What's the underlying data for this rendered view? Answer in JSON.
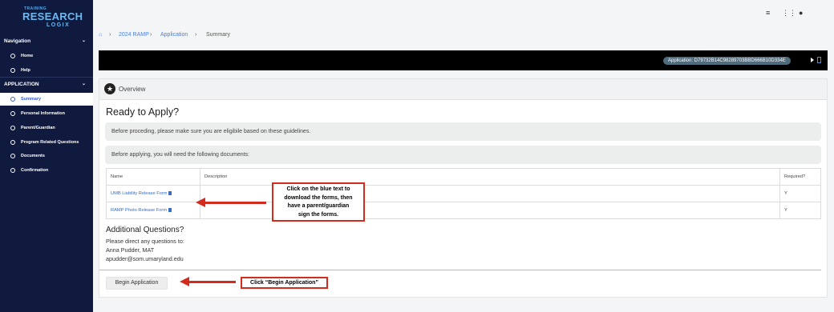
{
  "brand": {
    "line1": "TRAINING",
    "line2": "RESEARCH",
    "line3": "LOGIX"
  },
  "sidebar": {
    "nav_header": "Navigation",
    "nav_items": [
      {
        "label": "Home",
        "icon": "home-icon"
      },
      {
        "label": "Help",
        "icon": "help-icon"
      }
    ],
    "app_header": "APPLICATION",
    "app_items": [
      {
        "label": "Summary",
        "active": true
      },
      {
        "label": "Personal Information"
      },
      {
        "label": "Parent/Guardian"
      },
      {
        "label": "Program Related Questions"
      },
      {
        "label": "Documents"
      },
      {
        "label": "Confirmation"
      }
    ]
  },
  "breadcrumb": {
    "items": [
      "2024 RAMP",
      "Application",
      "Summary"
    ]
  },
  "application_badge": "Application: D79732B14C98289703BBD666B10D334E",
  "overview": {
    "title": "Overview",
    "heading": "Ready to Apply?",
    "eligibility_note": "Before proceding, please make sure you are eligibile based on these guidelines.",
    "documents_note": "Before applying, you will need the following documents:",
    "table": {
      "headers": [
        "Name",
        "Description",
        "Required?"
      ],
      "rows": [
        {
          "name": "UMB Liability Release Form",
          "description": "",
          "required": "Y"
        },
        {
          "name": "RAMP Photo Release Form",
          "description": "",
          "required": "Y"
        }
      ]
    },
    "additional_heading": "Additional Questions?",
    "additional_lines": [
      "Please direct any questions to:",
      "Anna Pudder, MAT",
      "apudder@som.umaryland.edu"
    ],
    "begin_button": "Begin Application"
  },
  "annotations": {
    "callout_forms": [
      "Click on the blue text to",
      "download the forms, then",
      "have a parent/guardian",
      "sign the forms."
    ],
    "callout_begin": "Click “Begin Application”",
    "accent_color": "#d42b1f"
  }
}
